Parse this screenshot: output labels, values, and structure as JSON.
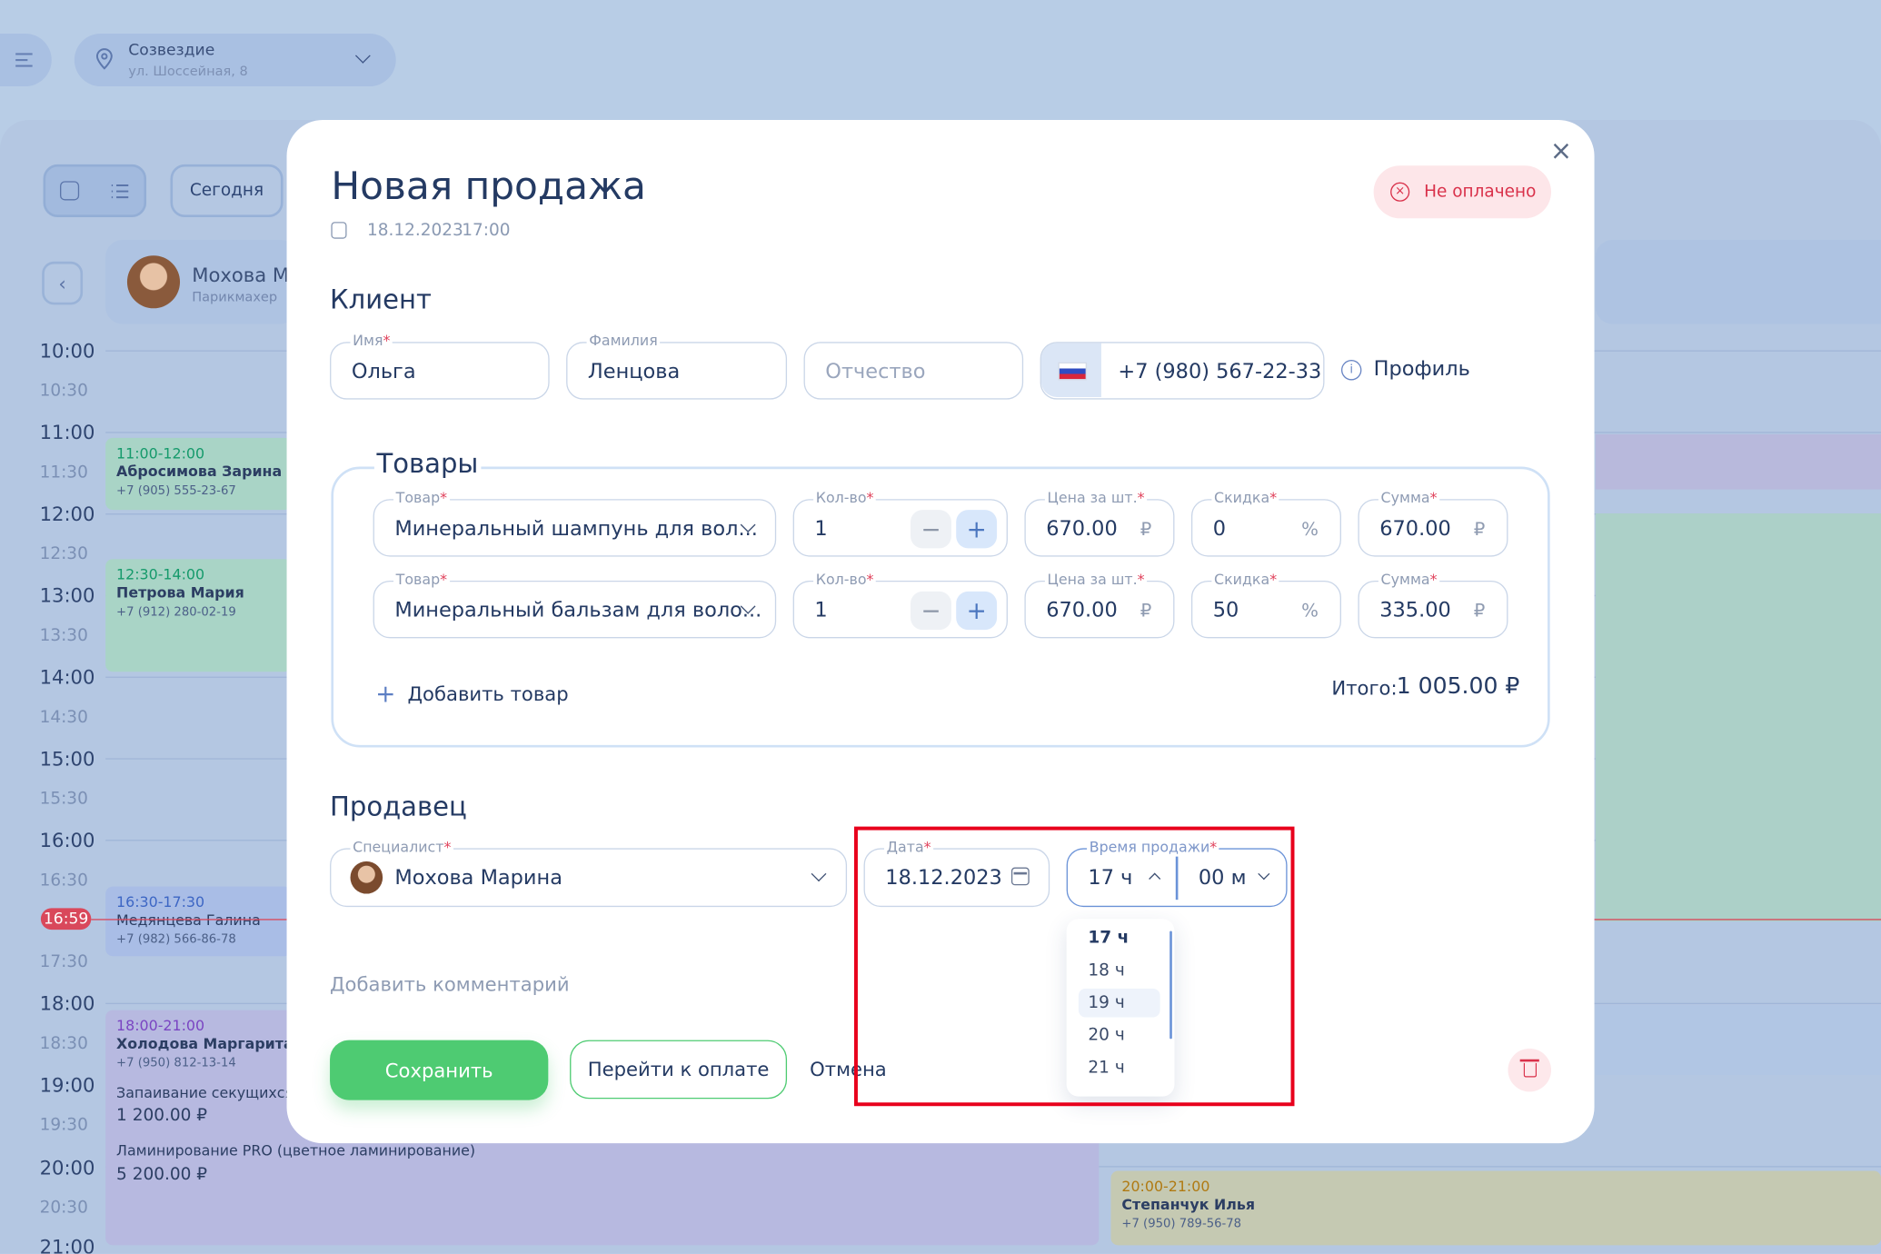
{
  "topbar": {
    "location_name": "Созвездие",
    "location_address": "ул. Шоссейная, 8"
  },
  "toolbar": {
    "today_label": "Сегодня"
  },
  "staff": {
    "name": "Мохова М",
    "role": "Парикмахер"
  },
  "timeline": {
    "labels": [
      "10:00",
      "10:30",
      "11:00",
      "11:30",
      "12:00",
      "12:30",
      "13:00",
      "13:30",
      "14:00",
      "14:30",
      "15:00",
      "15:30",
      "16:00",
      "16:30",
      "17:30",
      "18:00",
      "18:30",
      "19:00",
      "19:30",
      "20:00",
      "20:30",
      "21:00"
    ],
    "now": "16:59"
  },
  "events": [
    {
      "time": "11:00-12:00",
      "name": "Абросимова Зарина",
      "phone": "+7 (905) 555-23-67"
    },
    {
      "time": "12:30-14:00",
      "name": "Петрова Мария",
      "phone": "+7 (912) 280-02-19"
    },
    {
      "time": "16:30-17:30",
      "name": "Медянцева Галина",
      "phone": "+7 (982) 566-86-78"
    },
    {
      "time": "18:00-21:00",
      "name": "Холодова Маргарита",
      "phone": "+7 (950) 812-13-14",
      "service1": "Запаивание секущихся",
      "price1": "1 200.00 ₽",
      "service2": "Ламинирование PRO (цветное ламинирование)",
      "price2": "5 200.00 ₽"
    },
    {
      "time": "20:00-21:00",
      "name": "Степанчук Илья",
      "phone": "+7 (950) 789-56-78"
    }
  ],
  "modal": {
    "title": "Новая продажа",
    "date": "18.12.2023",
    "time": "17:00",
    "status": "Не оплачено",
    "client_section": "Клиент",
    "client": {
      "first_name_label": "Имя",
      "first_name": "Ольга",
      "last_name_label": "Фамилия",
      "last_name": "Ленцова",
      "middle_name_placeholder": "Отчество",
      "phone": "+7 (980) 567-22-33",
      "profile_label": "Профиль"
    },
    "goods_section": "Товары",
    "goods_labels": {
      "product": "Товар",
      "qty": "Кол-во",
      "price": "Цена за шт.",
      "discount": "Скидка",
      "sum": "Сумма",
      "currency": "₽",
      "percent": "%"
    },
    "goods": [
      {
        "product": "Минеральный шампунь для вол...",
        "qty": "1",
        "price": "670.00",
        "discount": "0",
        "sum": "670.00"
      },
      {
        "product": "Минеральный бальзам для воло...",
        "qty": "1",
        "price": "670.00",
        "discount": "50",
        "sum": "335.00"
      }
    ],
    "add_good_label": "Добавить товар",
    "total_label": "Итого:",
    "total_value": "1 005.00 ₽",
    "seller_section": "Продавец",
    "seller": {
      "specialist_label": "Специалист",
      "specialist": "Мохова Марина",
      "date_label": "Дата",
      "date": "18.12.2023",
      "time_label": "Время продажи",
      "hour": "17 ч",
      "minute": "00 м",
      "hour_options": [
        "17 ч",
        "18 ч",
        "19 ч",
        "20 ч",
        "21 ч"
      ]
    },
    "comment_label": "Добавить комментарий",
    "save_label": "Сохранить",
    "pay_label": "Перейти к оплате",
    "cancel_label": "Отмена"
  }
}
